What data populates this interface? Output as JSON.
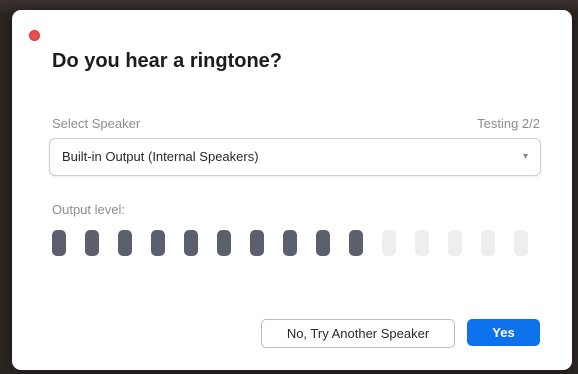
{
  "dialog": {
    "title": "Do you hear a ringtone?",
    "select_label": "Select Speaker",
    "testing_label": "Testing 2/2",
    "speaker_value": "Built-in Output (Internal Speakers)",
    "output_label": "Output level:",
    "output_level": {
      "active_segments": 10,
      "total_segments": 15
    },
    "buttons": {
      "try_another": "No, Try Another Speaker",
      "yes": "Yes"
    }
  },
  "colors": {
    "accent": "#0e72ed",
    "close": "#ee4b4b",
    "meter_active": "#5b5f6e",
    "meter_inactive": "#eeeeee"
  },
  "icons": {
    "close": "close-icon",
    "dropdown": "chevron-down-icon"
  }
}
